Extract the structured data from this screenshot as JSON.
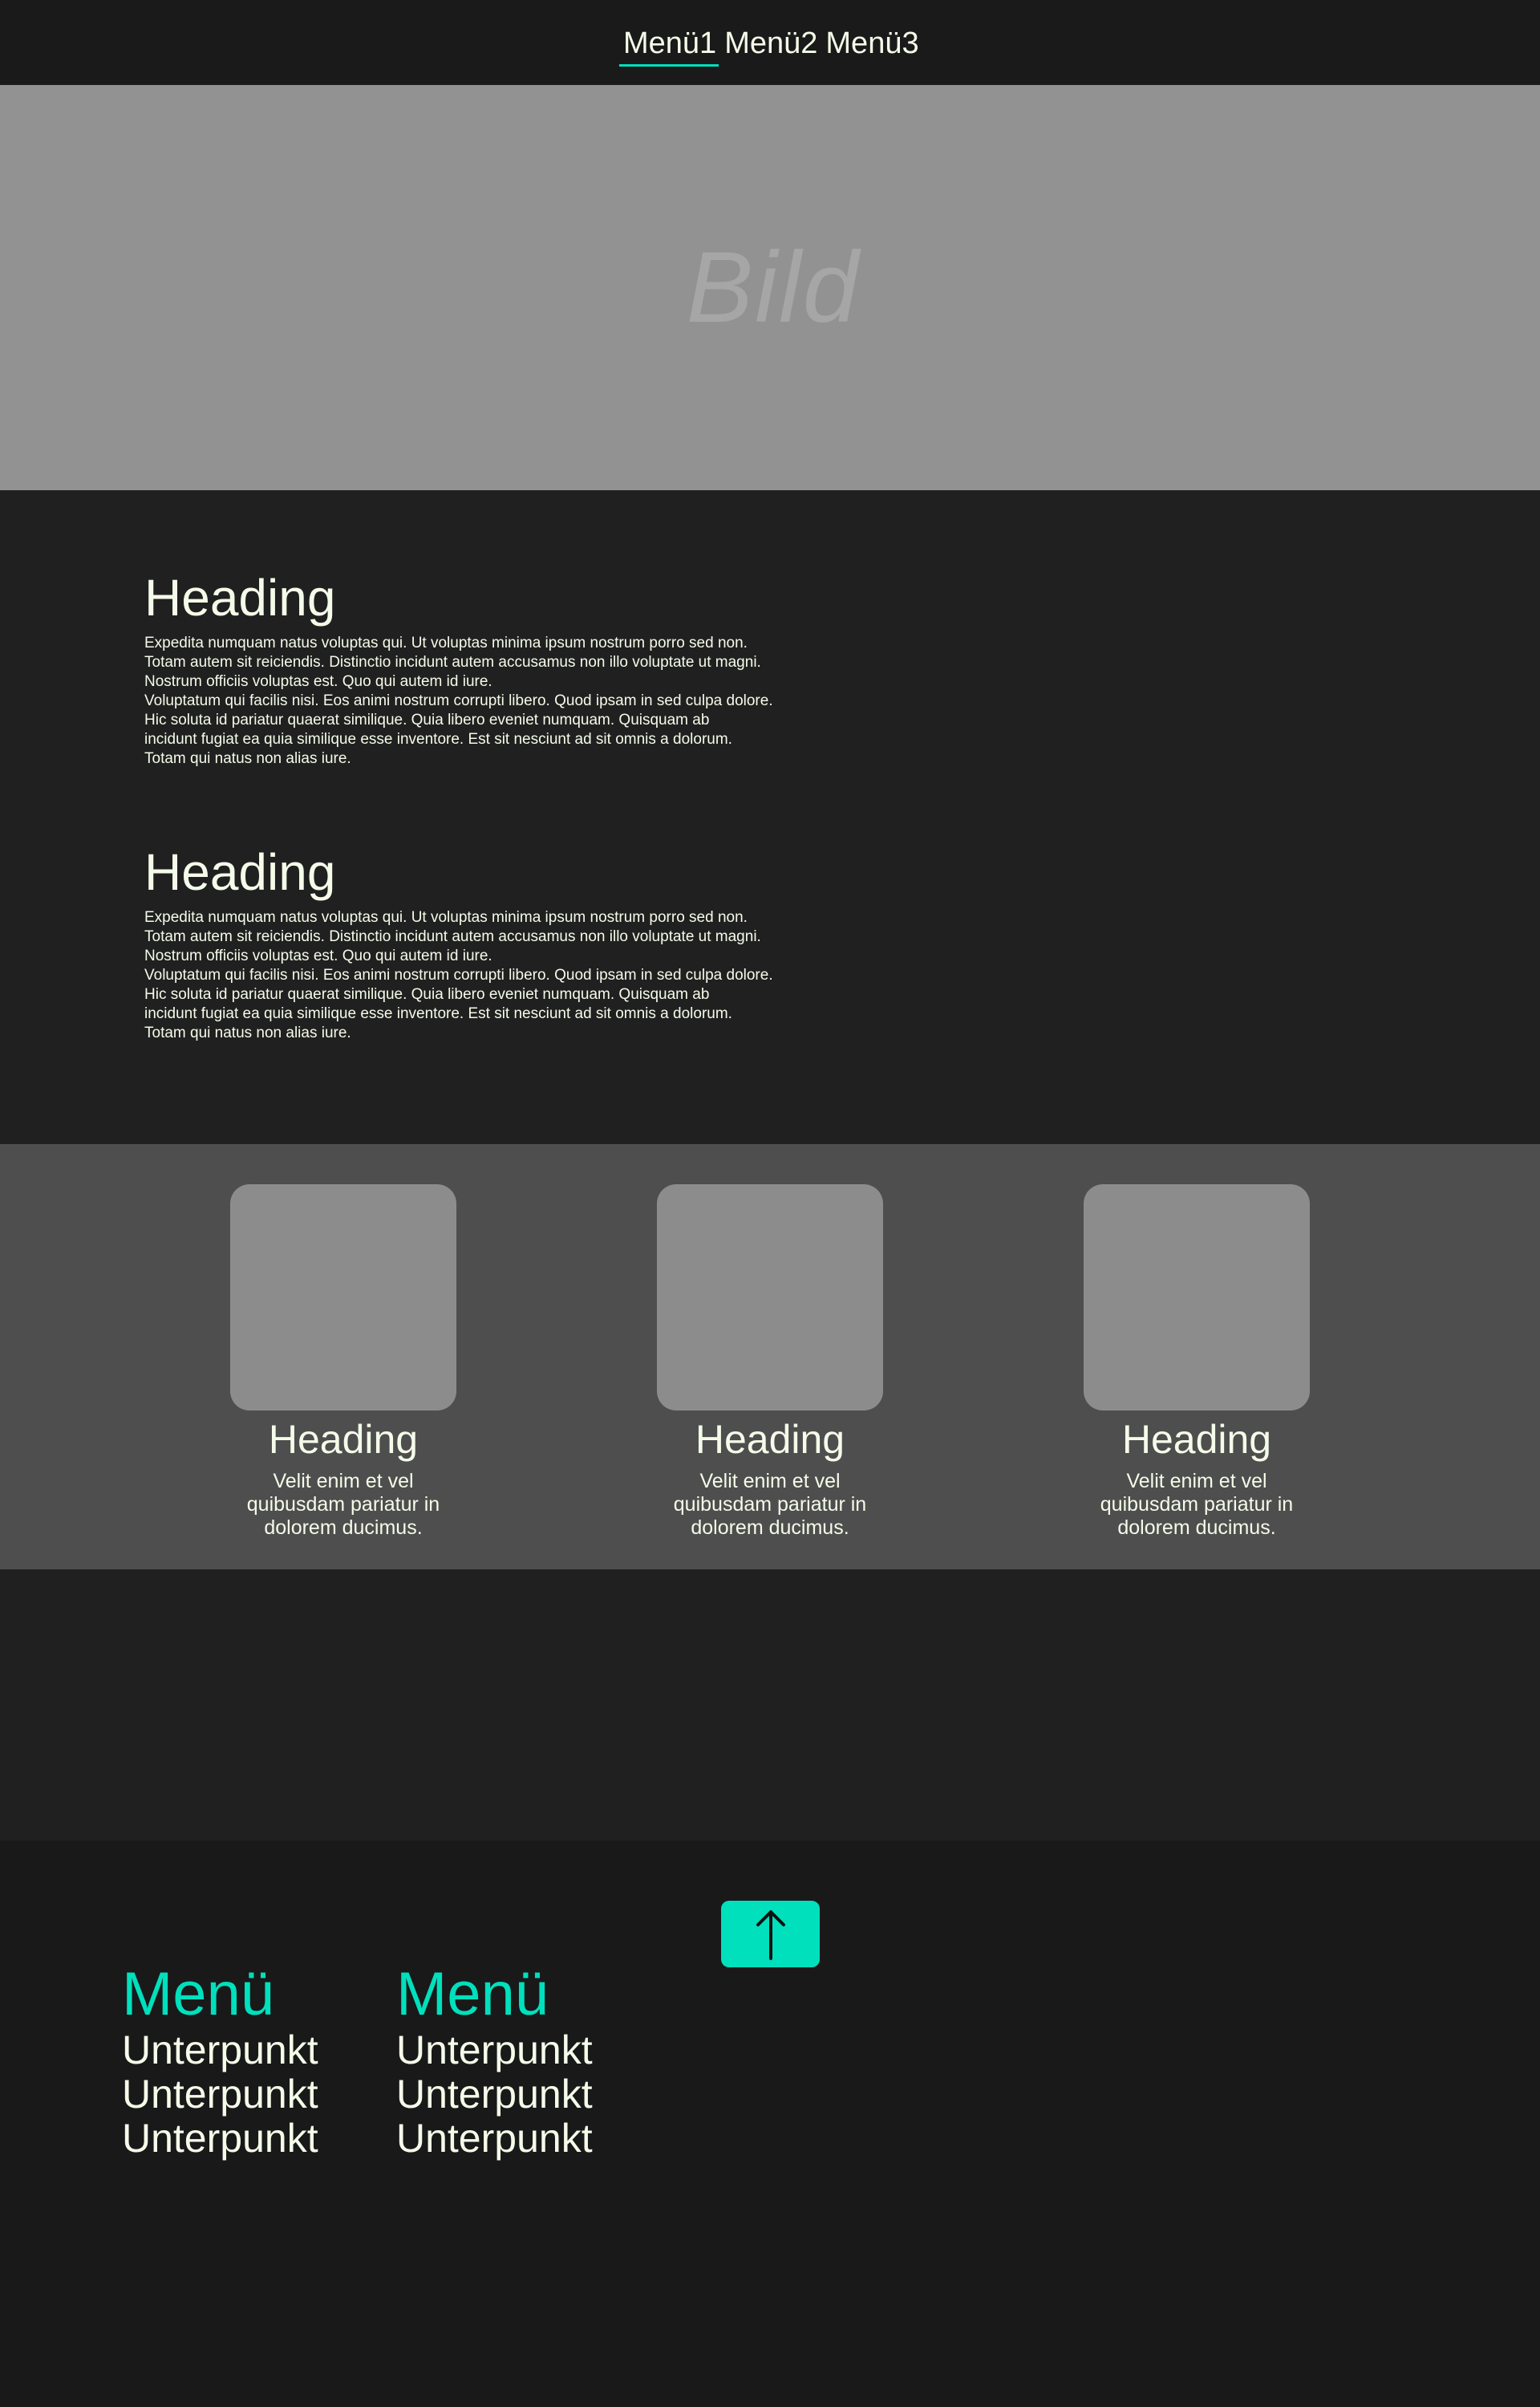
{
  "nav": {
    "items": [
      {
        "label": "Menü1",
        "active": true
      },
      {
        "label": "Menü2",
        "active": false
      },
      {
        "label": "Menü3",
        "active": false
      }
    ]
  },
  "hero": {
    "label": "Bild"
  },
  "sections": [
    {
      "heading": "Heading",
      "body": "Expedita numquam natus voluptas qui. Ut voluptas minima ipsum nostrum porro sed non.\nTotam autem sit reiciendis. Distinctio incidunt autem accusamus non illo voluptate ut magni.\nNostrum officiis voluptas est. Quo qui autem id iure.\nVoluptatum qui facilis nisi. Eos animi nostrum corrupti libero. Quod ipsam in sed culpa dolore.\nHic soluta id pariatur quaerat similique. Quia libero eveniet numquam. Quisquam ab\nincidunt fugiat ea quia similique esse inventore. Est sit nesciunt ad sit omnis a dolorum.\nTotam qui natus non alias iure."
    },
    {
      "heading": "Heading",
      "body": "Expedita numquam natus voluptas qui. Ut voluptas minima ipsum nostrum porro sed non.\nTotam autem sit reiciendis. Distinctio incidunt autem accusamus non illo voluptate ut magni.\nNostrum officiis voluptas est. Quo qui autem id iure.\nVoluptatum qui facilis nisi. Eos animi nostrum corrupti libero. Quod ipsam in sed culpa dolore.\nHic soluta id pariatur quaerat similique. Quia libero eveniet numquam. Quisquam ab\nincidunt fugiat ea quia similique esse inventore. Est sit nesciunt ad sit omnis a dolorum.\nTotam qui natus non alias iure."
    }
  ],
  "cards": [
    {
      "heading": "Heading",
      "text": "Velit enim et vel quibusdam pariatur in dolorem ducimus."
    },
    {
      "heading": "Heading",
      "text": "Velit enim et vel quibusdam pariatur in dolorem ducimus."
    },
    {
      "heading": "Heading",
      "text": "Velit enim et vel quibusdam pariatur in dolorem ducimus."
    }
  ],
  "footer": {
    "back_to_top_icon": "arrow-up-icon",
    "columns": [
      {
        "heading": "Menü",
        "links": [
          "Unterpunkt",
          "Unterpunkt",
          "Unterpunkt"
        ]
      },
      {
        "heading": "Menü",
        "links": [
          "Unterpunkt",
          "Unterpunkt",
          "Unterpunkt"
        ]
      }
    ]
  },
  "colors": {
    "accent": "#00e0bd",
    "text": "#f4fbe9",
    "page_background": "#202020",
    "nav_background": "#1a1a1a",
    "hero_background": "#929292",
    "card_band_background": "#4e4e4e",
    "card_image_background": "#8c8c8c",
    "footer_background": "#191919"
  }
}
